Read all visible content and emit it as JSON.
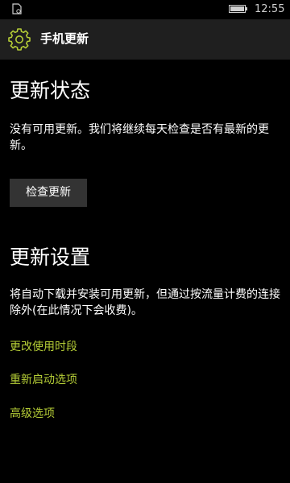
{
  "status_bar": {
    "time": "12:55",
    "left_icon": "app-indicator-icon",
    "battery_icon": "battery-icon"
  },
  "header": {
    "icon": "gear-icon",
    "title": "手机更新",
    "accent_color": "#b4cc36"
  },
  "update_status": {
    "heading": "更新状态",
    "description": "没有可用更新。我们将继续每天检查是否有最新的更新。",
    "check_button_label": "检查更新"
  },
  "update_settings": {
    "heading": "更新设置",
    "description": "将自动下载并安装可用更新，但通过按流量计费的连接除外(在此情况下会收费)。",
    "links": [
      {
        "label": "更改使用时段"
      },
      {
        "label": "重新启动选项"
      },
      {
        "label": "高级选项"
      }
    ]
  }
}
